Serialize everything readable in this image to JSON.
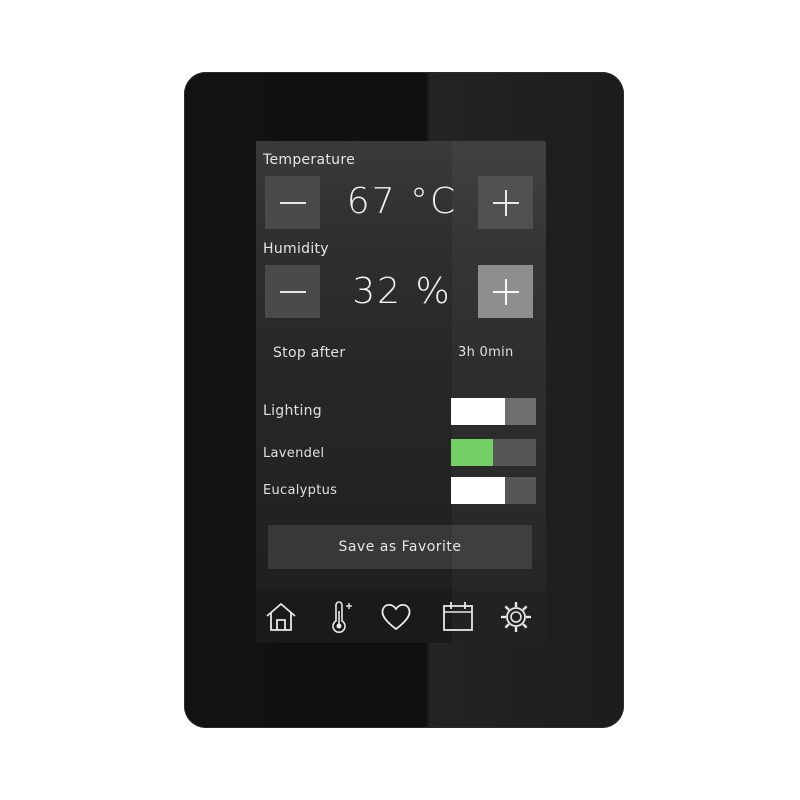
{
  "temperature": {
    "label": "Temperature",
    "value": "67 °C"
  },
  "humidity": {
    "label": "Humidity",
    "value": "32 %"
  },
  "timer": {
    "label": "Stop after",
    "value": "3h 0min"
  },
  "toggles": {
    "lighting": {
      "label": "Lighting"
    },
    "lavendel": {
      "label": "Lavendel"
    },
    "eucalyptus": {
      "label": "Eucalyptus"
    }
  },
  "save_label": "Save as Favorite",
  "nav": [
    "home-icon",
    "thermometer-icon",
    "heart-icon",
    "calendar-icon",
    "gear-icon"
  ],
  "colors": {
    "accent_green": "#6fcf5f",
    "screen_bg": "#2a2a2a",
    "bezel": "#111111"
  }
}
